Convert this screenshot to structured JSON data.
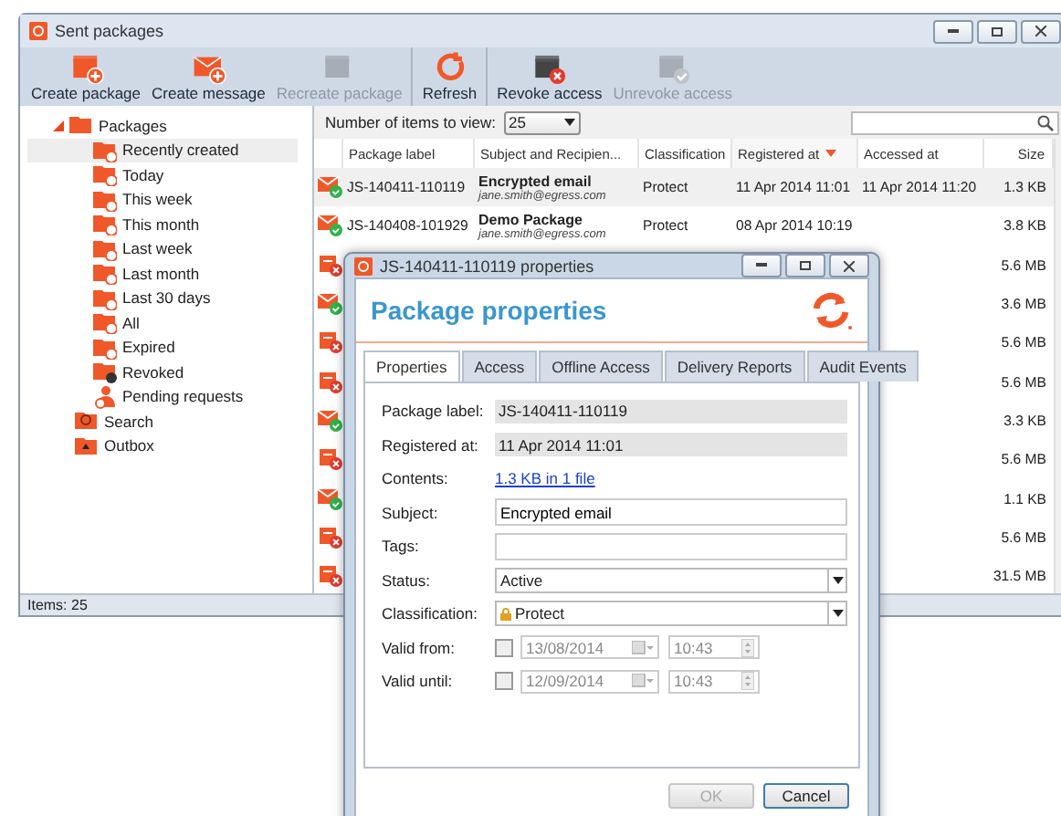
{
  "window": {
    "title": "Sent packages"
  },
  "toolbar": [
    {
      "label": "Create package",
      "disabled": false
    },
    {
      "label": "Create message",
      "disabled": false
    },
    {
      "label": "Recreate package",
      "disabled": true
    },
    {
      "label": "Refresh",
      "disabled": false
    },
    {
      "label": "Revoke access",
      "disabled": false
    },
    {
      "label": "Unrevoke access",
      "disabled": true
    }
  ],
  "tree": [
    {
      "label": "Packages",
      "kind": "folder",
      "expanded": true,
      "selected": false,
      "children": [
        {
          "label": "Recently created",
          "kind": "filter",
          "selected": true
        },
        {
          "label": "Today",
          "kind": "filter",
          "selected": false
        },
        {
          "label": "This week",
          "kind": "filter",
          "selected": false
        },
        {
          "label": "This month",
          "kind": "filter",
          "selected": false
        },
        {
          "label": "Last week",
          "kind": "filter",
          "selected": false
        },
        {
          "label": "Last month",
          "kind": "filter",
          "selected": false
        },
        {
          "label": "Last 30 days",
          "kind": "filter",
          "selected": false
        },
        {
          "label": "All",
          "kind": "filter",
          "selected": false
        },
        {
          "label": "Expired",
          "kind": "filter",
          "selected": false
        },
        {
          "label": "Revoked",
          "kind": "revoked",
          "selected": false
        },
        {
          "label": "Pending requests",
          "kind": "requests",
          "selected": false
        }
      ]
    },
    {
      "label": "Search",
      "kind": "search",
      "selected": false
    },
    {
      "label": "Outbox",
      "kind": "outbox",
      "selected": false
    }
  ],
  "list": {
    "items_label": "Number of items to view:",
    "items_value": "25",
    "columns": [
      {
        "label": "Package label",
        "sorted": false
      },
      {
        "label": "Subject and Recipien...",
        "sorted": false
      },
      {
        "label": "Classification",
        "sorted": false
      },
      {
        "label": "Registered at",
        "sorted": true
      },
      {
        "label": "Accessed at",
        "sorted": false
      },
      {
        "label": "Size",
        "sorted": false
      }
    ],
    "rows": [
      {
        "revoked": false,
        "selected": true,
        "label": "JS-140411-110119",
        "subject": "Encrypted email",
        "recipient": "jane.smith@egress.com",
        "classification": "Protect",
        "registered": "11 Apr 2014 11:01",
        "accessed": "11 Apr 2014 11:20",
        "size": "1.3 KB"
      },
      {
        "revoked": false,
        "selected": false,
        "label": "JS-140408-101929",
        "subject": "Demo Package",
        "recipient": "jane.smith@egress.com",
        "classification": "Protect",
        "registered": "08 Apr 2014 10:19",
        "size": "3.8 KB"
      },
      {
        "revoked": true,
        "selected": false,
        "size": "5.6 MB"
      },
      {
        "revoked": false,
        "selected": false,
        "size": "3.6 MB"
      },
      {
        "revoked": true,
        "selected": false,
        "size": "5.6 MB"
      },
      {
        "revoked": true,
        "selected": false,
        "size": "5.6 MB"
      },
      {
        "revoked": false,
        "selected": false,
        "size": "3.3 KB"
      },
      {
        "revoked": true,
        "selected": false,
        "size": "5.6 MB"
      },
      {
        "revoked": false,
        "selected": false,
        "size": "1.1 KB"
      },
      {
        "revoked": true,
        "selected": false,
        "size": "5.6 MB"
      },
      {
        "revoked": true,
        "selected": false,
        "size": "31.5 MB"
      }
    ]
  },
  "status_bar": "Items: 25",
  "dialog": {
    "title": "JS-140411-110119 properties",
    "heading": "Package properties",
    "tabs": [
      {
        "label": "Properties",
        "selected": true
      },
      {
        "label": "Access",
        "selected": false
      },
      {
        "label": "Offline Access",
        "selected": false
      },
      {
        "label": "Delivery Reports",
        "selected": false
      },
      {
        "label": "Audit Events",
        "selected": false
      }
    ],
    "fields": [
      {
        "kind": "readonly",
        "label": "Package label:",
        "value": "JS-140411-110119"
      },
      {
        "kind": "readonly",
        "label": "Registered at:",
        "value": "11 Apr 2014 11:01"
      },
      {
        "kind": "link",
        "label": "Contents:",
        "value": "1.3 KB in 1 file"
      },
      {
        "kind": "text",
        "label": "Subject:",
        "value": "Encrypted email"
      },
      {
        "kind": "text",
        "label": "Tags:"
      },
      {
        "kind": "select",
        "label": "Status:",
        "value": "Active"
      },
      {
        "kind": "select-lock",
        "label": "Classification:",
        "value": "Protect"
      },
      {
        "kind": "date",
        "label": "Valid from:",
        "checked": false,
        "date": "13/08/2014",
        "time": "10:43"
      },
      {
        "kind": "date",
        "label": "Valid until:",
        "checked": false,
        "date": "12/09/2014",
        "time": "10:43"
      }
    ],
    "buttons": [
      {
        "label": "OK",
        "disabled": true
      },
      {
        "label": "Cancel",
        "disabled": false
      }
    ]
  }
}
